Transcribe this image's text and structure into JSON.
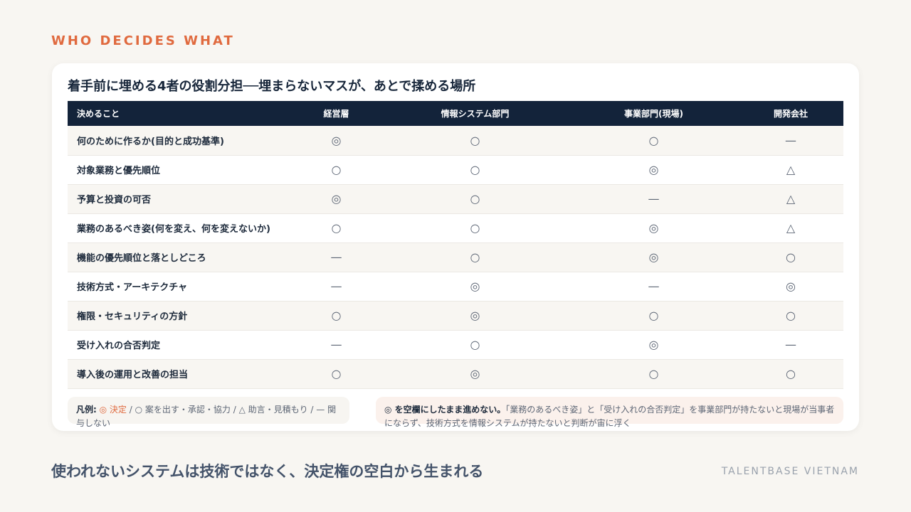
{
  "kicker": "WHO DECIDES WHAT",
  "card": {
    "title": "着手前に埋める4者の役割分担──埋まらないマスが、あとで揉める場所",
    "columns": [
      "決めること",
      "経営層",
      "情報システム部門",
      "事業部門(現場)",
      "開発会社"
    ],
    "rows": [
      {
        "item": "何のために作るか(目的と成功基準)",
        "cells": [
          "◎",
          "○",
          "○",
          "—"
        ]
      },
      {
        "item": "対象業務と優先順位",
        "cells": [
          "○",
          "○",
          "◎",
          "△"
        ]
      },
      {
        "item": "予算と投資の可否",
        "cells": [
          "◎",
          "○",
          "—",
          "△"
        ]
      },
      {
        "item": "業務のあるべき姿(何を変え、何を変えないか)",
        "cells": [
          "○",
          "○",
          "◎",
          "△"
        ]
      },
      {
        "item": "機能の優先順位と落としどころ",
        "cells": [
          "—",
          "○",
          "◎",
          "○"
        ]
      },
      {
        "item": "技術方式・アーキテクチャ",
        "cells": [
          "—",
          "◎",
          "—",
          "◎"
        ]
      },
      {
        "item": "権限・セキュリティの方針",
        "cells": [
          "○",
          "◎",
          "○",
          "○"
        ]
      },
      {
        "item": "受け入れの合否判定",
        "cells": [
          "—",
          "○",
          "◎",
          "—"
        ]
      },
      {
        "item": "導入後の運用と改善の担当",
        "cells": [
          "○",
          "◎",
          "○",
          "○"
        ]
      }
    ],
    "legend": {
      "label": "凡例:",
      "decide": "◎ 決定",
      "rest": " / ○ 案を出す・承認・協力 / △ 助言・見積もり / — 関与しない"
    },
    "note": {
      "bold": "◎ を空欄にしたまま進めない。",
      "text": "「業務のあるべき姿」と「受け入れの合否判定」を事業部門が持たないと現場が当事者にならず、技術方式を情報システムが持たないと判断が宙に浮く"
    }
  },
  "tagline": "使われないシステムは技術ではなく、決定権の空白から生まれる",
  "brand": "TALENTBASE VIETNAM",
  "colors": {
    "accent": "#e06a3f",
    "header_bg": "#13233a",
    "page_bg": "#f8f6f2",
    "note_bg": "#fbf1ec"
  }
}
